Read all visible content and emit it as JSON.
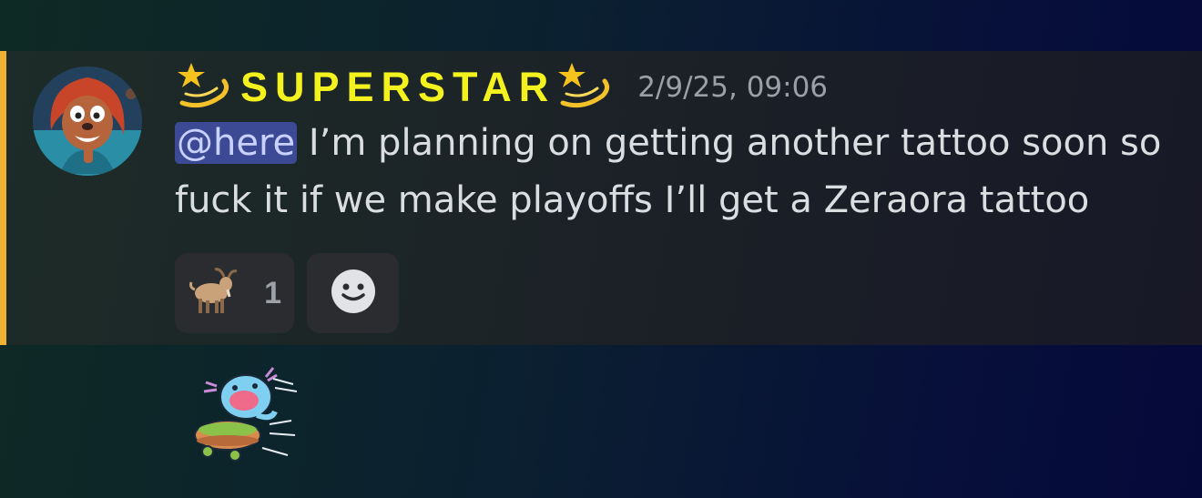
{
  "message": {
    "username": "SUPERSTAR",
    "name_prefix_icon": "dizzy-star-emoji",
    "name_suffix_icon": "dizzy-star-emoji",
    "timestamp": "2/9/25, 09:06",
    "mention": "@here",
    "text": " I’m planning on getting another tattoo soon so fuck it if we make playoffs I’ll get a Zeraora tattoo",
    "colors": {
      "username": "#f4f21e",
      "mention_bar": "#f0b232",
      "mention_bg": "#3c4a96"
    }
  },
  "reactions": [
    {
      "emoji": "goat-emoji",
      "count": "1"
    },
    {
      "emoji": "add-reaction-smiley-icon"
    }
  ],
  "sticker": {
    "icon": "wooper-skateboard-sticker"
  }
}
